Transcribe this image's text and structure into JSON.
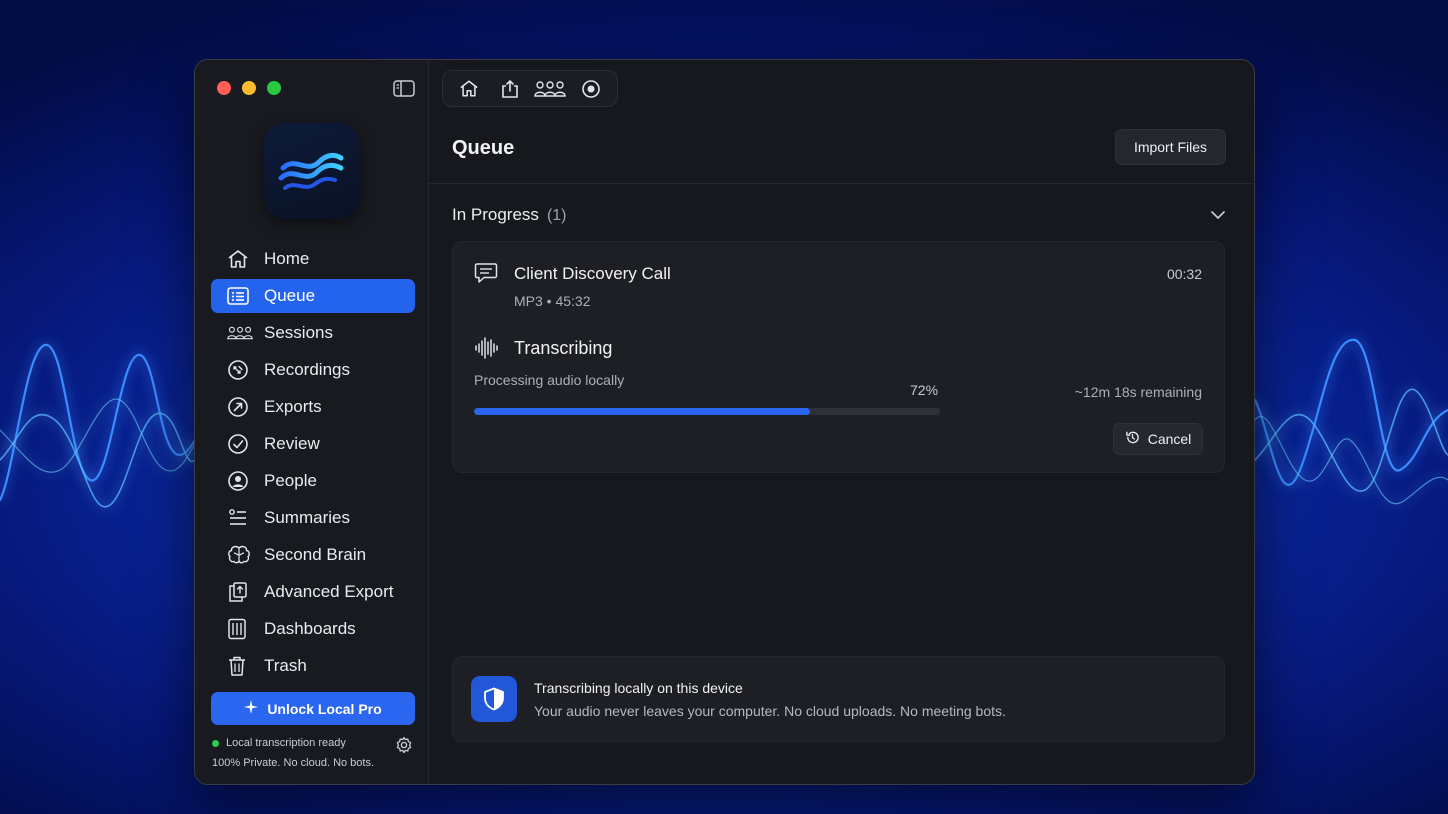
{
  "window": {
    "sidebar": {
      "items": [
        {
          "label": "Home",
          "icon": "home-icon"
        },
        {
          "label": "Queue",
          "icon": "queue-icon",
          "active": true
        },
        {
          "label": "Sessions",
          "icon": "people-group-icon"
        },
        {
          "label": "Recordings",
          "icon": "recordings-icon"
        },
        {
          "label": "Exports",
          "icon": "export-arrow-icon"
        },
        {
          "label": "Review",
          "icon": "check-circle-icon"
        },
        {
          "label": "People",
          "icon": "person-circle-icon"
        },
        {
          "label": "Summaries",
          "icon": "list-icon"
        },
        {
          "label": "Second Brain",
          "icon": "brain-icon"
        },
        {
          "label": "Advanced Export",
          "icon": "copy-export-icon"
        },
        {
          "label": "Dashboards",
          "icon": "dashboard-icon"
        },
        {
          "label": "Trash",
          "icon": "trash-icon"
        }
      ],
      "unlock_label": "Unlock Local Pro",
      "status_label": "Local transcription ready",
      "status_sub": "100% Private. No cloud. No bots."
    },
    "main": {
      "title": "Queue",
      "import_label": "Import Files",
      "section": {
        "title": "In Progress",
        "count": "(1)"
      },
      "job": {
        "title": "Client Discovery Call",
        "meta": "MP3 • 45:32",
        "elapsed": "00:32",
        "state": "Transcribing",
        "sub": "Processing audio locally",
        "progress_label": "72%",
        "progress": 0.72,
        "remaining": "~12m 18s remaining",
        "cancel_label": "Cancel"
      },
      "privacy": {
        "title": "Transcribing locally on this device",
        "desc": "Your audio never leaves your computer. No cloud uploads. No meeting bots."
      }
    }
  },
  "colors": {
    "accent": "#2463eb",
    "window_bg": "#16181e",
    "card_bg": "#1d1f25",
    "status_green": "#2ecc4f"
  }
}
